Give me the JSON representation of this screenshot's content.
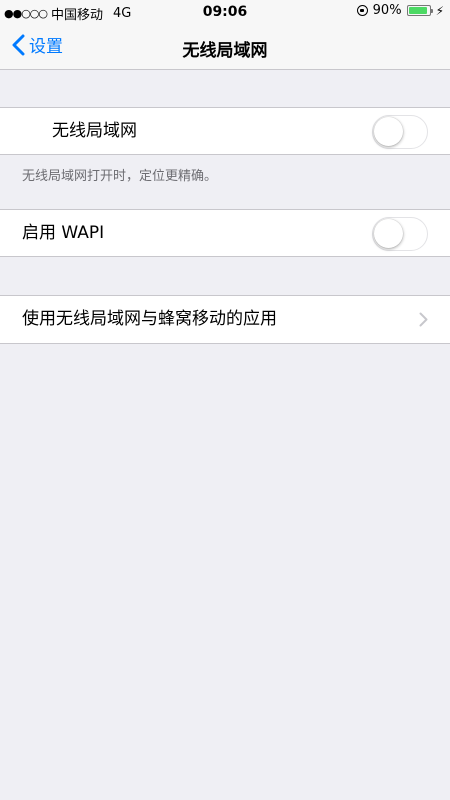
{
  "status_bar": {
    "signal": "●●○○○",
    "carrier": "中国移动",
    "network": "4G",
    "time": "09:06",
    "battery_percent": "90%",
    "battery_level": 0.9,
    "icons": [
      "signal-dots-icon",
      "orientation-lock-icon",
      "battery-icon",
      "charging-bolt-icon"
    ],
    "battery_color": "#4cd964"
  },
  "nav": {
    "back_label": "设置",
    "title": "无线局域网",
    "accent_color": "#007aff"
  },
  "wlan": {
    "label": "无线局域网",
    "enabled": false,
    "footer": "无线局域网打开时，定位更精确。"
  },
  "wapi": {
    "label": "启用 WAPI",
    "enabled": false
  },
  "cellular_apps": {
    "label": "使用无线局域网与蜂窝移动的应用"
  }
}
